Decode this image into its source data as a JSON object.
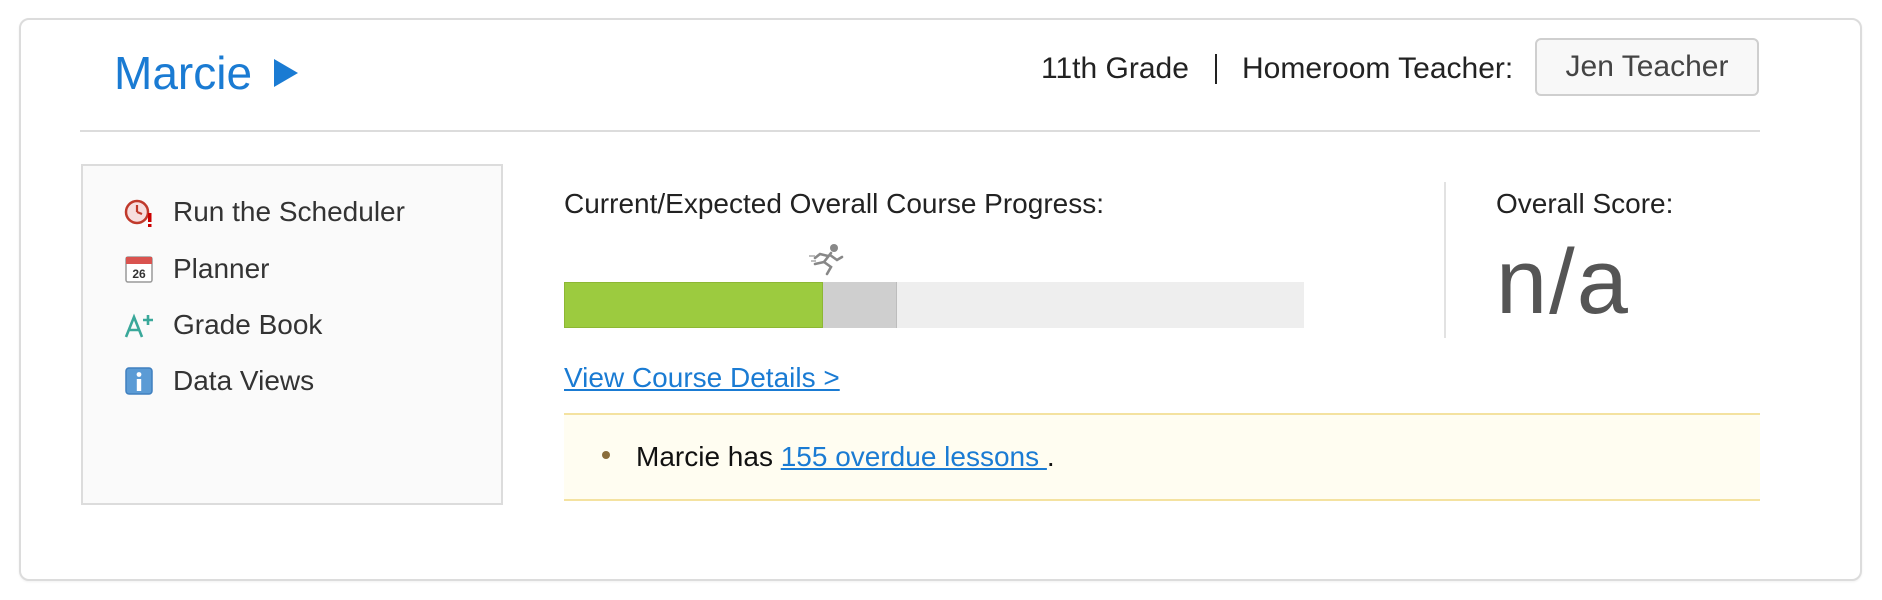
{
  "student": {
    "name": "Marcie"
  },
  "header": {
    "grade": "11th Grade",
    "homeroom_label": "Homeroom Teacher:",
    "teacher": "Jen Teacher"
  },
  "sidebar": {
    "items": [
      {
        "label": "Run the Scheduler",
        "icon": "clock-alert-icon"
      },
      {
        "label": "Planner",
        "icon": "calendar-icon",
        "icon_text": "26"
      },
      {
        "label": "Grade Book",
        "icon": "grade-a-plus-icon"
      },
      {
        "label": "Data Views",
        "icon": "info-icon"
      }
    ]
  },
  "progress": {
    "label": "Current/Expected Overall Course Progress:",
    "current_fraction": 0.35,
    "expected_fraction": 0.45,
    "colors": {
      "current": "#9ccb3f",
      "expected": "#cfcfcf",
      "track": "#eeeeee"
    },
    "expected_marker_icon": "runner-icon"
  },
  "score": {
    "label": "Overall Score:",
    "value": "n/a"
  },
  "course_link": "View Course Details >",
  "alert": {
    "prefix": "Marcie has ",
    "link": "155 overdue lessons ",
    "suffix": "."
  },
  "colors": {
    "accent": "#1a7bd3",
    "alert_bg": "#fffdf1",
    "alert_border": "#f4e2a0"
  }
}
